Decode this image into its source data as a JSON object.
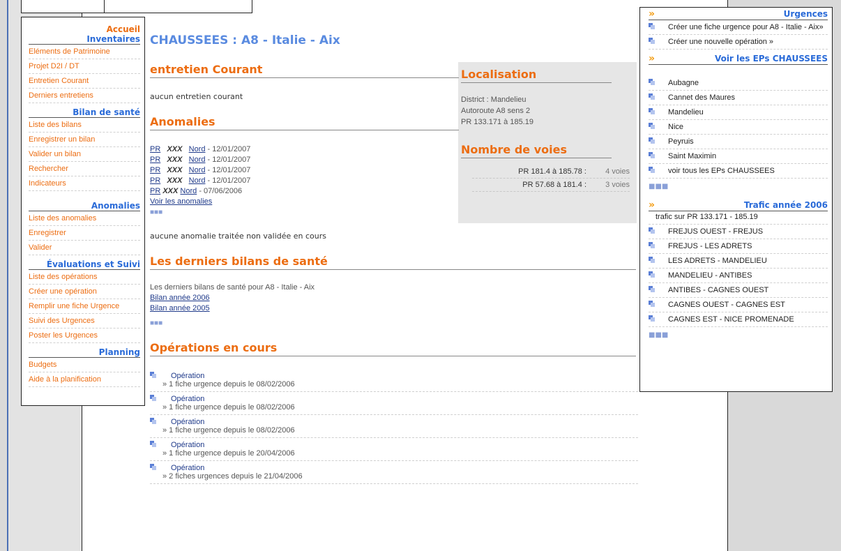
{
  "sidebar": {
    "accueil": "Accueil",
    "sections": [
      {
        "title": "Inventaires",
        "items": [
          "Eléments de Patrimoine",
          "Projet D2I / DT",
          "Entretien Courant",
          "Derniers entretiens"
        ]
      },
      {
        "title": "Bilan de santé",
        "items": [
          "Liste des bilans",
          "Enregistrer un bilan",
          "Valider un bilan",
          "Rechercher",
          "Indicateurs"
        ]
      },
      {
        "title": "Anomalies",
        "items": [
          "Liste des anomalies",
          "Enregistrer",
          "Valider"
        ]
      },
      {
        "title": "Évaluations et Suivi",
        "items": [
          "Liste des opérations",
          "Créer une opération",
          "Remplir une fiche Urgence",
          "Suivi des Urgences",
          "Poster les Urgences"
        ]
      },
      {
        "title": "Planning",
        "items": [
          "Budgets",
          "Aide à la planification"
        ]
      }
    ]
  },
  "main": {
    "title": "CHAUSSEES : A8 - Italie - Aix",
    "entretien": {
      "title": "entretien Courant",
      "text": "aucun entretien courant"
    },
    "anomalies": {
      "title": "Anomalies",
      "rows": [
        {
          "pr": "PR",
          "xxx": "XXX",
          "dir": "Nord",
          "date": " - 12/01/2007"
        },
        {
          "pr": "PR",
          "xxx": "XXX",
          "dir": "Nord",
          "date": " - 12/01/2007"
        },
        {
          "pr": "PR",
          "xxx": "XXX",
          "dir": "Nord",
          "date": " - 12/01/2007"
        },
        {
          "pr": "PR",
          "xxx": "XXX",
          "dir": "Nord",
          "date": " - 12/01/2007"
        },
        {
          "pr": "PR",
          "xxx": "XXX",
          "dir": "Nord",
          "date": " - 07/06/2006"
        }
      ],
      "voir": "Voir les anomalies",
      "none_text": "aucune anomalie traitée non validée en cours"
    },
    "bilans": {
      "title": "Les derniers bilans de santé",
      "intro": "Les derniers bilans de santé pour A8 - Italie - Aix",
      "links": [
        "Bilan année 2006",
        "Bilan année 2005"
      ]
    },
    "operations": {
      "title": "Opérations en cours",
      "items": [
        {
          "label": "Opération",
          "sub": "» 1 fiche urgence depuis le 08/02/2006"
        },
        {
          "label": "Opération",
          "sub": "» 1 fiche urgence depuis le 08/02/2006"
        },
        {
          "label": "Opération",
          "sub": "» 1 fiche urgence depuis le 08/02/2006"
        },
        {
          "label": "Opération",
          "sub": "» 1 fiche urgence depuis le 20/04/2006"
        },
        {
          "label": "Opération",
          "sub": "» 2 fiches urgences depuis le 21/04/2006"
        }
      ]
    }
  },
  "localisation": {
    "title": "Localisation",
    "lines": [
      "District : Mandelieu",
      "Autoroute A8 sens 2",
      "PR 133.171 à 185.19"
    ],
    "voies_title": "Nombre de voies",
    "voies": [
      {
        "range": "PR 181.4 à 185.78 :",
        "count": "4 voies"
      },
      {
        "range": "PR 57.68 à 181.4 :",
        "count": "3 voies"
      }
    ]
  },
  "right": {
    "urgences": {
      "title": "Urgences",
      "items": [
        "Créer une fiche urgence pour A8 - Italie - Aix»",
        "Créer une nouvelle opération »"
      ]
    },
    "eps": {
      "title": "Voir les EPs CHAUSSEES",
      "items": [
        "Aubagne",
        "Cannet des Maures",
        "Mandelieu",
        "Nice",
        "Peyruis",
        "Saint Maximin",
        "voir tous les EPs CHAUSSEES"
      ]
    },
    "trafic": {
      "title": "Trafic année 2006",
      "header_item": "trafic sur PR 133.171 - 185.19",
      "items": [
        "FREJUS OUEST - FREJUS",
        "FREJUS - LES ADRETS",
        "LES ADRETS - MANDELIEU",
        "MANDELIEU - ANTIBES",
        "ANTIBES - CAGNES OUEST",
        "CAGNES OUEST - CAGNES EST",
        "CAGNES EST - NICE PROMENADE"
      ]
    },
    "chevron": "»"
  }
}
